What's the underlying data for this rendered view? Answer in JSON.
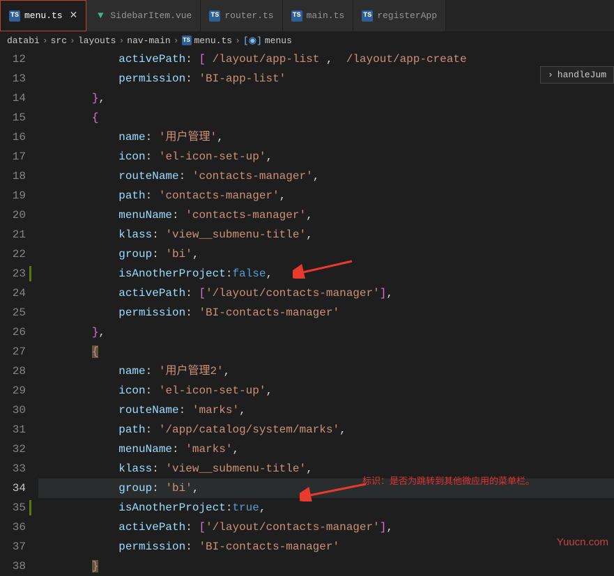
{
  "tabs": [
    {
      "label": "menu.ts",
      "type": "ts",
      "active": true
    },
    {
      "label": "SidebarItem.vue",
      "type": "vue",
      "active": false
    },
    {
      "label": "router.ts",
      "type": "ts",
      "active": false
    },
    {
      "label": "main.ts",
      "type": "ts",
      "active": false
    },
    {
      "label": "registerApp",
      "type": "ts",
      "active": false
    }
  ],
  "breadcrumb": {
    "parts": [
      "databi",
      "src",
      "layouts",
      "nav-main",
      "menu.ts",
      "menus"
    ]
  },
  "outline": {
    "label": "handleJum"
  },
  "lines": [
    {
      "n": "12",
      "html": "            <span class='c-prop'>activePath</span><span class='c-punc'>:</span> <span class='c-brace'>[</span> <span class='c-str'>/layout/app-list</span> <span class='c-punc'>,</span>  <span class='c-str'>/layout/app-create</span>"
    },
    {
      "n": "13",
      "html": "            <span class='c-prop'>permission</span><span class='c-punc'>:</span> <span class='c-str'>'BI-app-list'</span>"
    },
    {
      "n": "14",
      "html": "        <span class='c-brace'>}</span><span class='c-punc'>,</span>"
    },
    {
      "n": "15",
      "html": "        <span class='c-brace'>{</span>"
    },
    {
      "n": "16",
      "html": "            <span class='c-prop'>name</span><span class='c-punc'>:</span> <span class='c-str'>'用户管理'</span><span class='c-punc'>,</span>"
    },
    {
      "n": "17",
      "html": "            <span class='c-prop'>icon</span><span class='c-punc'>:</span> <span class='c-str'>'el-icon-set-up'</span><span class='c-punc'>,</span>"
    },
    {
      "n": "18",
      "html": "            <span class='c-prop'>routeName</span><span class='c-punc'>:</span> <span class='c-str'>'contacts-manager'</span><span class='c-punc'>,</span>"
    },
    {
      "n": "19",
      "html": "            <span class='c-prop'>path</span><span class='c-punc'>:</span> <span class='c-str'>'contacts-manager'</span><span class='c-punc'>,</span>"
    },
    {
      "n": "20",
      "html": "            <span class='c-prop'>menuName</span><span class='c-punc'>:</span> <span class='c-str'>'contacts-manager'</span><span class='c-punc'>,</span>"
    },
    {
      "n": "21",
      "html": "            <span class='c-prop'>klass</span><span class='c-punc'>:</span> <span class='c-str'>'view__submenu-title'</span><span class='c-punc'>,</span>"
    },
    {
      "n": "22",
      "html": "            <span class='c-prop'>group</span><span class='c-punc'>:</span> <span class='c-str'>'bi'</span><span class='c-punc'>,</span>"
    },
    {
      "n": "23",
      "mod": true,
      "html": "            <span class='c-prop'>isAnotherProject</span><span class='c-punc'>:</span><span class='c-bool'>false</span><span class='c-punc'>,</span>"
    },
    {
      "n": "24",
      "html": "            <span class='c-prop'>activePath</span><span class='c-punc'>:</span> <span class='c-brace'>[</span><span class='c-str'>'/layout/contacts-manager'</span><span class='c-brace'>]</span><span class='c-punc'>,</span>"
    },
    {
      "n": "25",
      "html": "            <span class='c-prop'>permission</span><span class='c-punc'>:</span> <span class='c-str'>'BI-contacts-manager'</span>"
    },
    {
      "n": "26",
      "html": "        <span class='c-brace'>}</span><span class='c-punc'>,</span>"
    },
    {
      "n": "27",
      "html": "        <span class='c-brace' style='background:#5a5a2a'>{</span>"
    },
    {
      "n": "28",
      "html": "            <span class='c-prop'>name</span><span class='c-punc'>:</span> <span class='c-str'>'用户管理2'</span><span class='c-punc'>,</span>"
    },
    {
      "n": "29",
      "html": "            <span class='c-prop'>icon</span><span class='c-punc'>:</span> <span class='c-str'>'el-icon-set-up'</span><span class='c-punc'>,</span>"
    },
    {
      "n": "30",
      "html": "            <span class='c-prop'>routeName</span><span class='c-punc'>:</span> <span class='c-str'>'marks'</span><span class='c-punc'>,</span>"
    },
    {
      "n": "31",
      "html": "            <span class='c-prop'>path</span><span class='c-punc'>:</span> <span class='c-str'>'/app/catalog/system/marks'</span><span class='c-punc'>,</span>"
    },
    {
      "n": "32",
      "html": "            <span class='c-prop'>menuName</span><span class='c-punc'>:</span> <span class='c-str'>'marks'</span><span class='c-punc'>,</span>"
    },
    {
      "n": "33",
      "html": "            <span class='c-prop'>klass</span><span class='c-punc'>:</span> <span class='c-str'>'view__submenu-title'</span><span class='c-punc'>,</span>"
    },
    {
      "n": "34",
      "current": true,
      "hl": true,
      "html": "            <span class='c-prop'>group</span><span class='c-punc'>:</span> <span class='c-str'>'bi'</span><span class='c-punc'>,</span>"
    },
    {
      "n": "35",
      "mod": true,
      "html": "            <span class='c-prop'>isAnotherProject</span><span class='c-punc'>:</span><span class='c-bool'>true</span><span class='c-punc'>,</span>"
    },
    {
      "n": "36",
      "html": "            <span class='c-prop'>activePath</span><span class='c-punc'>:</span> <span class='c-brace'>[</span><span class='c-str'>'/layout/contacts-manager'</span><span class='c-brace'>]</span><span class='c-punc'>,</span>"
    },
    {
      "n": "37",
      "html": "            <span class='c-prop'>permission</span><span class='c-punc'>:</span> <span class='c-str'>'BI-contacts-manager'</span>"
    },
    {
      "n": "38",
      "html": "        <span class='c-brace' style='background:#5a5a2a'>}</span>"
    }
  ],
  "annotation": {
    "text": "标识：是否为跳转到其他微应用的菜单栏。"
  },
  "watermark": {
    "text": "Yuucn.com"
  }
}
